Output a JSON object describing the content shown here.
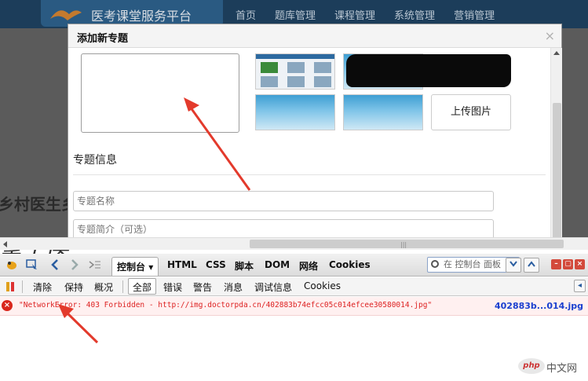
{
  "site": {
    "title": "医考课堂服务平台",
    "nav": [
      "首页",
      "题库管理",
      "课程管理",
      "系统管理",
      "营销管理"
    ],
    "side_text": [
      "乡村医生乡",
      "掌上医"
    ]
  },
  "modal": {
    "title": "添加新专题",
    "close": "×",
    "upload_label": "上传图片",
    "section_title": "专题信息",
    "fields": [
      {
        "placeholder": "专题名称"
      },
      {
        "placeholder": "专题简介（可选）"
      }
    ]
  },
  "firebug": {
    "panel_tabs": [
      "控制台",
      "HTML",
      "CSS",
      "脚本",
      "DOM",
      "网络",
      "Cookies"
    ],
    "active_tab_suffix": "▾",
    "search_placeholder": "在 控制台 面板",
    "filters": [
      "清除",
      "保持",
      "概况",
      "全部",
      "错误",
      "警告",
      "消息",
      "调试信息",
      "Cookies"
    ],
    "active_filter": "全部",
    "error": {
      "message": "\"NetworkError: 403 Forbidden - http://img.doctorpda.cn/402883b74efcc05c014efcee30580014.jpg\"",
      "source": "402883b...014.jpg"
    }
  },
  "watermark": {
    "logo": "php",
    "text": "中文网"
  },
  "colors": {
    "header_bg": "#1c3d5a",
    "error_red": "#d22",
    "link_blue": "#1a3fcf",
    "annotation": "#e33a2c"
  }
}
